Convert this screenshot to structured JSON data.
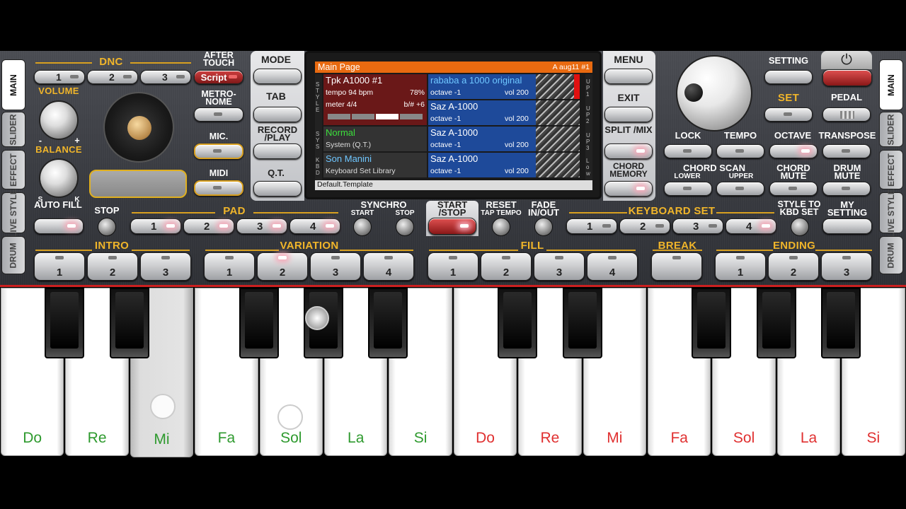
{
  "tabs_left": [
    "MAIN",
    "SLIDER",
    "EFFECT",
    "LIVE STYLE",
    "DRUM"
  ],
  "tabs_right": [
    "MAIN",
    "SLIDER",
    "EFFECT",
    "LIVE STYLE",
    "DRUM"
  ],
  "dnc": {
    "title": "DNC",
    "buttons": [
      "1",
      "2",
      "3"
    ],
    "after_touch": "AFTER TOUCH",
    "script": "Script"
  },
  "volume": "VOLUME",
  "balance": "BALANCE",
  "balance_minus": "-",
  "balance_plus": "+",
  "balance_s": "S",
  "balance_k": "K",
  "metronome": "METRO- NOME",
  "mic": "MIC.",
  "midi": "MIDI",
  "left_btns": {
    "mode": "MODE",
    "tab": "TAB",
    "record": "RECORD /PLAY",
    "qt": "Q.T."
  },
  "right_btns": {
    "menu": "MENU",
    "exit": "EXIT",
    "split": "SPLIT /MIX",
    "chord_memory": "CHORD MEMORY"
  },
  "screen": {
    "title": "Main Page",
    "chord": "A aug11 #1",
    "style_name": "Tpk A1000 #1",
    "tempo": "tempo 94 bpm",
    "percent": "78%",
    "meter": "meter 4/4",
    "transpose": "b/# +6",
    "up1_name": "rababa a 1000 original",
    "up1_oct": "octave -1",
    "up1_vol": "vol 200",
    "up2_name": "Saz A-1000",
    "up2_oct": "octave -1",
    "up2_vol": "vol 200",
    "row2_left": "Normal",
    "row2_left_sub": "System (Q.T.)",
    "up3_name": "Saz A-1000",
    "up3_oct": "octave -1",
    "up3_vol": "vol 200",
    "row3_left": "Son Manini",
    "row3_left_sub": "Keyboard Set Library",
    "low_name": "Saz A-1000",
    "low_oct": "octave -1",
    "low_vol": "vol 200",
    "footer": "Default.Template",
    "side_style": "STYLE",
    "side_sys": "SYS",
    "side_kbd": "KBD",
    "side_up1": "UP1",
    "side_up2": "UP2",
    "side_up3": "UP3",
    "side_low": "Low"
  },
  "setting": "SETTING",
  "set": "SET",
  "pedal": "PEDAL",
  "lock": "LOCK",
  "tempo": "TEMPO",
  "octave": "OCTAVE",
  "transpose": "TRANSPOSE",
  "chord_scan": "CHORD SCAN",
  "lower": "LOWER",
  "upper": "UPPER",
  "chord_mute": "CHORD MUTE",
  "drum_mute": "DRUM MUTE",
  "auto_fill": "AUTO FILL",
  "stop": "STOP",
  "pad": {
    "title": "PAD",
    "buttons": [
      "1",
      "2",
      "3",
      "4"
    ]
  },
  "synchro": "SYNCHRO",
  "synchro_start": "START",
  "synchro_stop": "STOP",
  "start_stop": "START /STOP",
  "reset": "RESET",
  "tap_tempo": "TAP TEMPO",
  "fade": "FADE IN/OUT",
  "keyboard_set": {
    "title": "KEYBOARD SET",
    "buttons": [
      "1",
      "2",
      "3",
      "4"
    ]
  },
  "style_to_kbd": "STYLE TO KBD SET",
  "my_setting": "MY SETTING",
  "intro": {
    "title": "INTRO",
    "buttons": [
      "1",
      "2",
      "3"
    ]
  },
  "variation": {
    "title": "VARIATION",
    "buttons": [
      "1",
      "2",
      "3",
      "4"
    ]
  },
  "fill": {
    "title": "FILL",
    "buttons": [
      "1",
      "2",
      "3",
      "4"
    ]
  },
  "break": "BREAK",
  "ending": {
    "title": "ENDING",
    "buttons": [
      "1",
      "2",
      "3"
    ]
  },
  "keys": [
    {
      "label": "Do",
      "color": "#2e9a2e"
    },
    {
      "label": "Re",
      "color": "#2e9a2e"
    },
    {
      "label": "Mi",
      "color": "#2e9a2e"
    },
    {
      "label": "Fa",
      "color": "#2e9a2e"
    },
    {
      "label": "Sol",
      "color": "#2e9a2e"
    },
    {
      "label": "La",
      "color": "#2e9a2e"
    },
    {
      "label": "Si",
      "color": "#2e9a2e"
    },
    {
      "label": "Do",
      "color": "#e03030"
    },
    {
      "label": "Re",
      "color": "#e03030"
    },
    {
      "label": "Mi",
      "color": "#e03030"
    },
    {
      "label": "Fa",
      "color": "#e03030"
    },
    {
      "label": "Sol",
      "color": "#e03030"
    },
    {
      "label": "La",
      "color": "#e03030"
    },
    {
      "label": "Si",
      "color": "#e03030"
    }
  ],
  "colors": {
    "gold": "#f0b52a",
    "screen_header": "#e86a10",
    "blue_cell": "#1e4a9a",
    "red_cell": "#6a1818",
    "accent_red": "#cc2020"
  }
}
